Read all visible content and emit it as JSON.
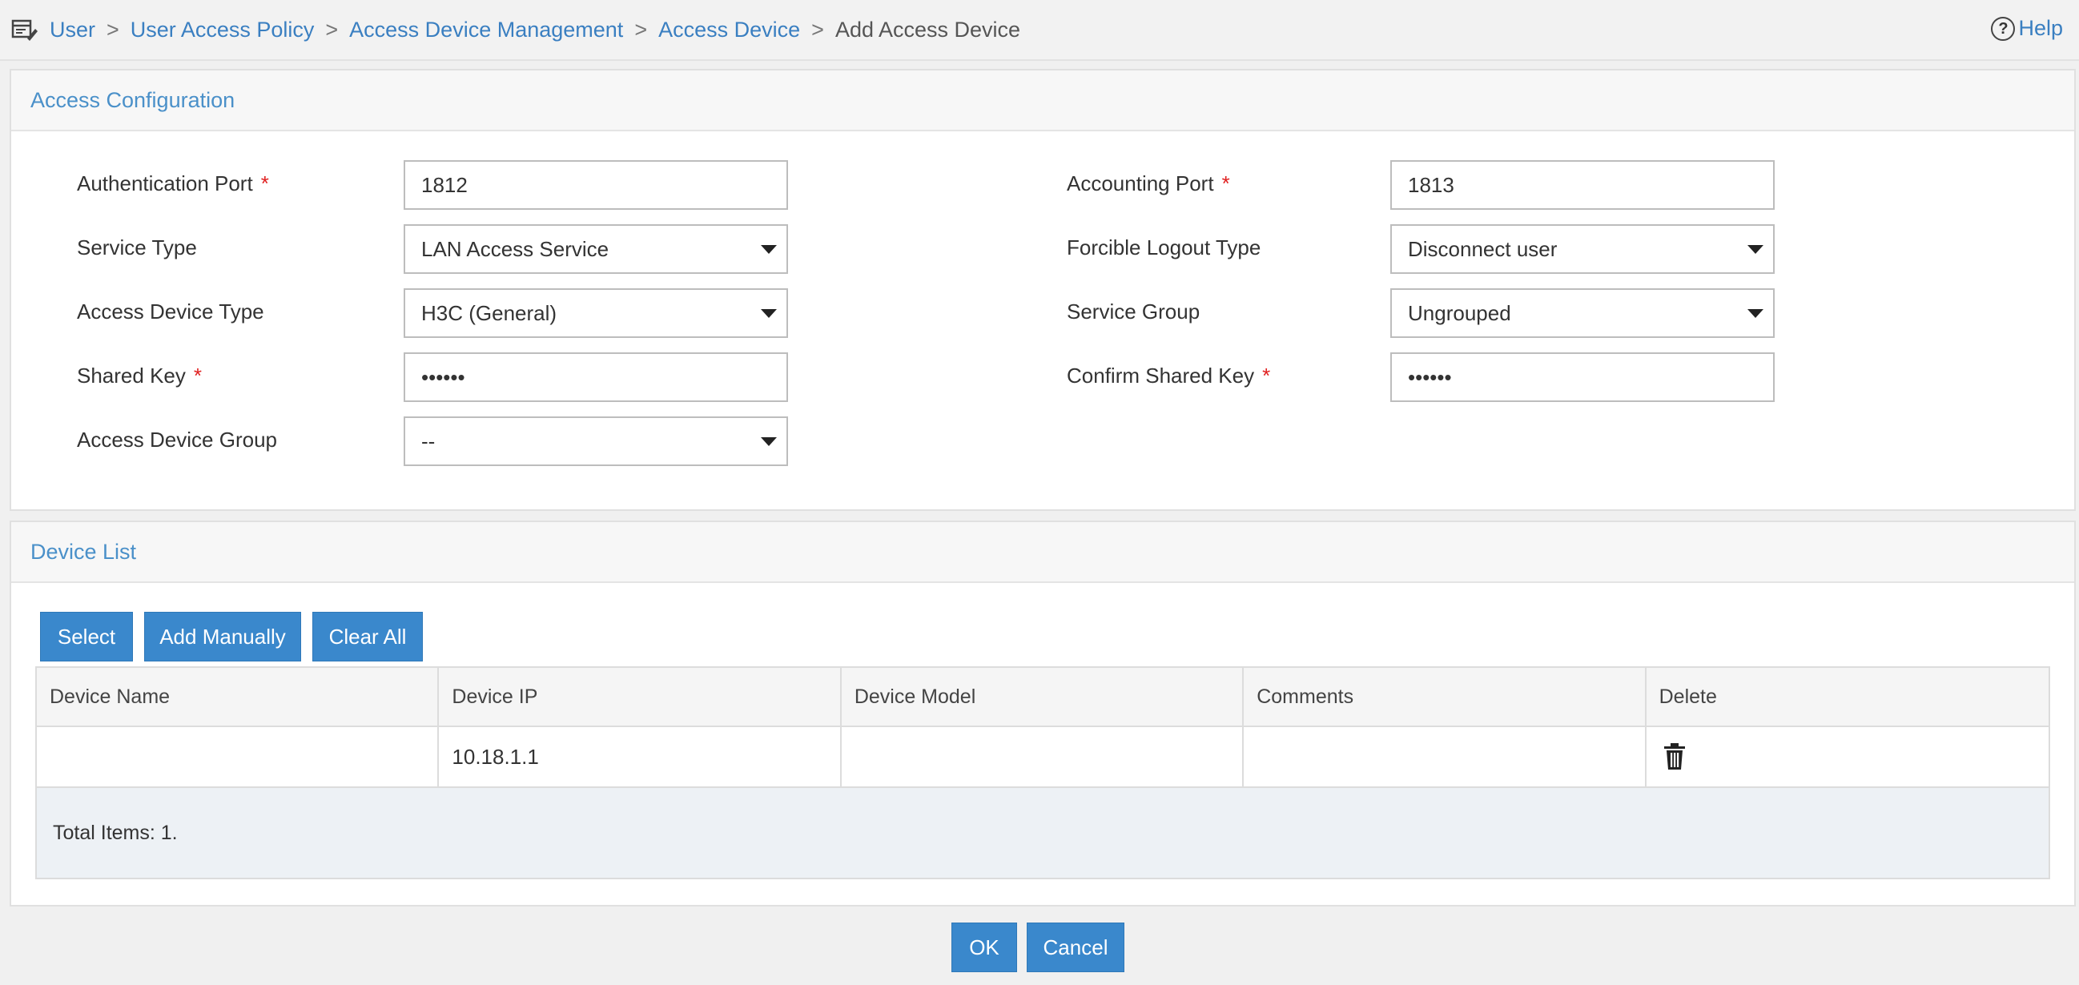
{
  "breadcrumb": {
    "items": [
      "User",
      "User Access Policy",
      "Access Device Management",
      "Access Device"
    ],
    "separator": ">",
    "current": "Add Access Device"
  },
  "help": {
    "icon": "?",
    "label": "Help"
  },
  "access_config": {
    "title": "Access Configuration",
    "required_mark": "*",
    "auth_port": {
      "label": "Authentication Port",
      "value": "1812"
    },
    "acct_port": {
      "label": "Accounting Port",
      "value": "1813"
    },
    "service_type": {
      "label": "Service Type",
      "value": "LAN Access Service"
    },
    "logout_type": {
      "label": "Forcible Logout Type",
      "value": "Disconnect user"
    },
    "device_type": {
      "label": "Access Device Type",
      "value": "H3C (General)"
    },
    "service_group": {
      "label": "Service Group",
      "value": "Ungrouped"
    },
    "shared_key": {
      "label": "Shared Key",
      "value": "••••••"
    },
    "confirm_key": {
      "label": "Confirm Shared Key",
      "value": "••••••"
    },
    "device_group": {
      "label": "Access Device Group",
      "value": "--"
    }
  },
  "device_list": {
    "title": "Device List",
    "buttons": {
      "select": "Select",
      "add_manually": "Add Manually",
      "clear_all": "Clear All"
    },
    "columns": [
      "Device Name",
      "Device IP",
      "Device Model",
      "Comments",
      "Delete"
    ],
    "rows": [
      {
        "name": "",
        "ip": "10.18.1.1",
        "model": "",
        "comments": "",
        "delete_icon": "trash-icon"
      }
    ],
    "total": "Total Items: 1."
  },
  "footer": {
    "ok": "OK",
    "cancel": "Cancel"
  },
  "colors": {
    "accent": "#3a88cc",
    "link": "#3a7fc1",
    "required": "#e02020"
  }
}
